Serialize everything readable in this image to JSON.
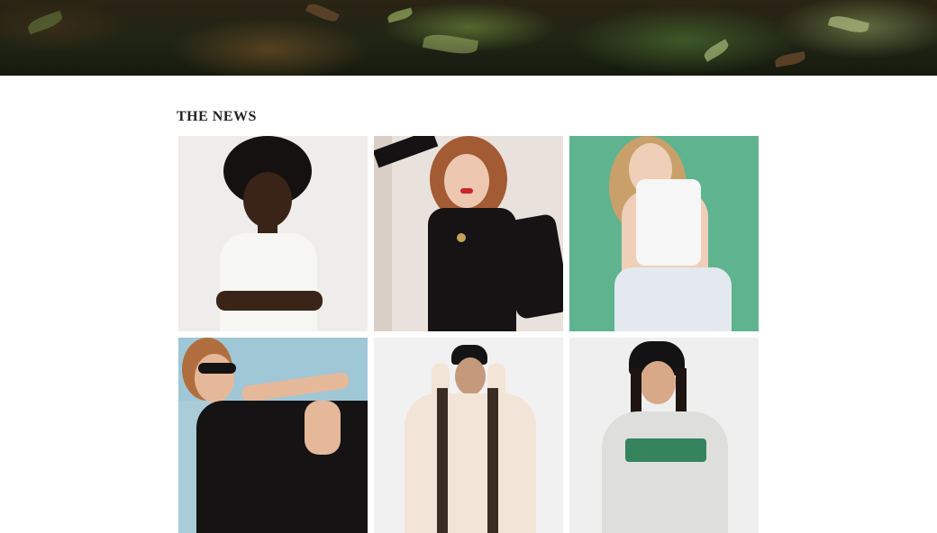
{
  "hero": {
    "image": "foliage-banner"
  },
  "news": {
    "title": "THE NEWS",
    "items": [
      {
        "image": "model-white-shirt-afro",
        "bg": "#efecec"
      },
      {
        "image": "model-black-turtleneck-red-hair",
        "bg": "#e9e2dc"
      },
      {
        "image": "model-white-top-green-backdrop",
        "bg": "#5fb48f"
      },
      {
        "image": "model-sunglasses-black-dress",
        "bg": "#9fc7d6"
      },
      {
        "image": "model-bucket-hat-braids",
        "bg": "#f1f1f1"
      },
      {
        "image": "model-bucket-hat-sweatshirt",
        "bg": "#efefef"
      }
    ]
  },
  "colors": {
    "title_text": "#222222",
    "page_background": "#ffffff"
  }
}
